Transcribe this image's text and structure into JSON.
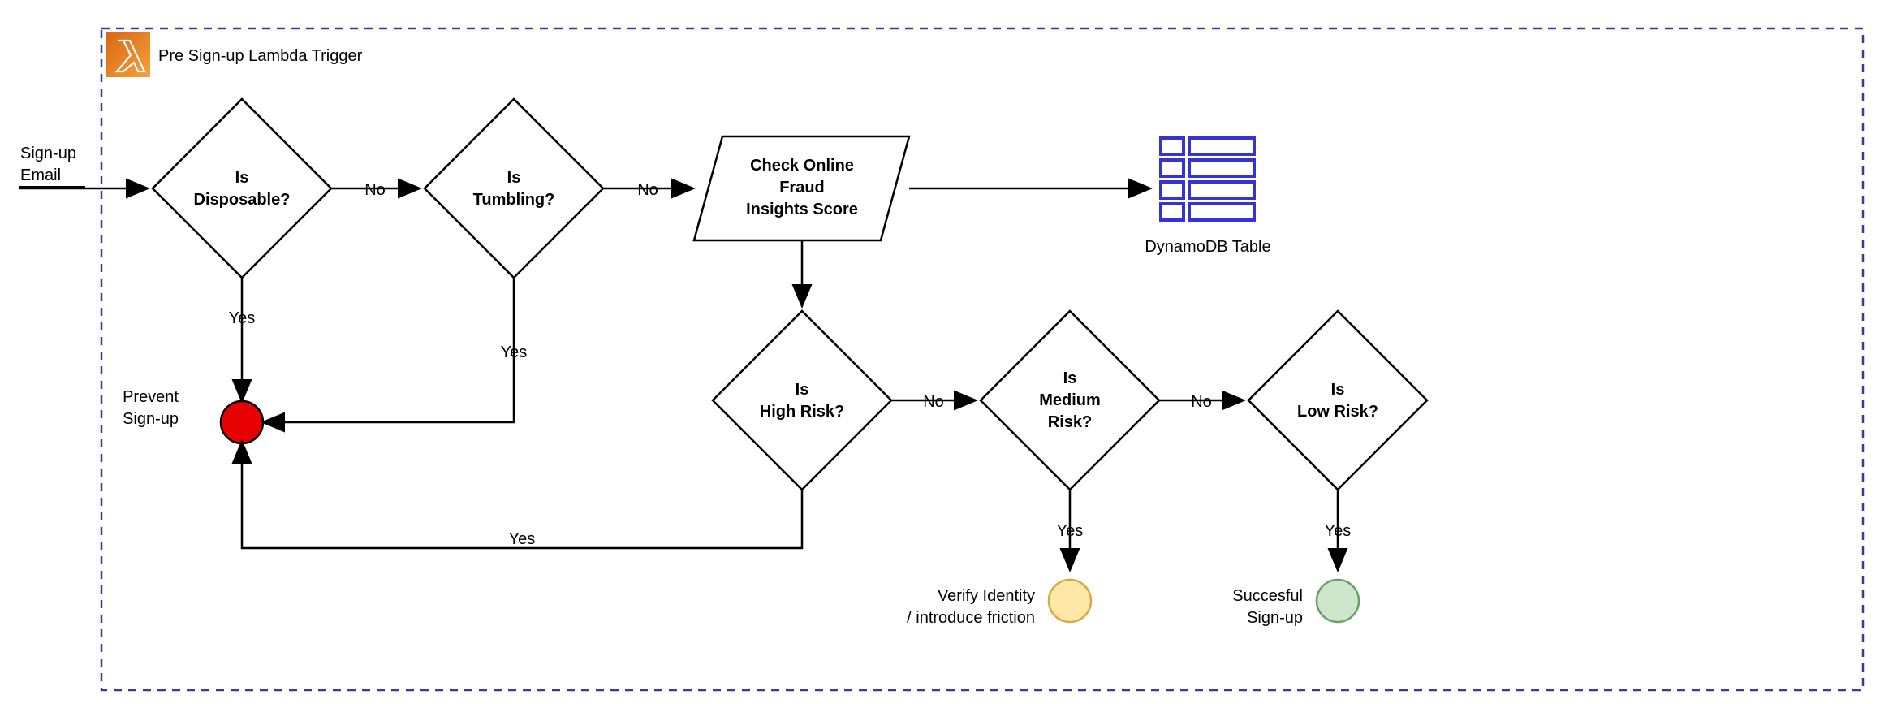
{
  "container_label": "Pre Sign-up Lambda Trigger",
  "input_label_line1": "Sign-up",
  "input_label_line2": "Email",
  "decisions": {
    "disposable_line1": "Is",
    "disposable_line2": "Disposable?",
    "tumbling_line1": "Is",
    "tumbling_line2": "Tumbling?",
    "high_risk_line1": "Is",
    "high_risk_line2": "High Risk?",
    "medium_line1": "Is",
    "medium_line2": "Medium",
    "medium_line3": "Risk?",
    "low_line1": "Is",
    "low_line2": "Low Risk?"
  },
  "process": {
    "check_line1": "Check Online",
    "check_line2": "Fraud",
    "check_line3": "Insights Score"
  },
  "outputs": {
    "dynamodb_label": "DynamoDB Table",
    "prevent_line1": "Prevent",
    "prevent_line2": "Sign-up",
    "verify_line1": "Verify Identity",
    "verify_line2": "/ introduce friction",
    "success_line1": "Succesful",
    "success_line2": "Sign-up"
  },
  "edges": {
    "no": "No",
    "yes": "Yes"
  }
}
